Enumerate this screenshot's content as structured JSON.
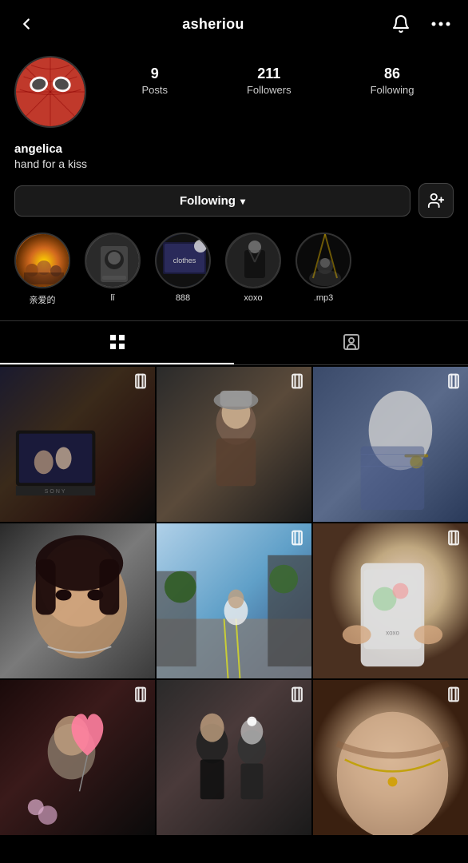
{
  "header": {
    "back_label": "‹",
    "title": "asheriou",
    "bell_icon": "🔔",
    "more_icon": "···"
  },
  "profile": {
    "avatar_alt": "Spider-Man avatar",
    "stats": [
      {
        "number": "9",
        "label": "Posts"
      },
      {
        "number": "211",
        "label": "Followers"
      },
      {
        "number": "86",
        "label": "Following"
      }
    ],
    "username": "angelica",
    "bio": "hand for a kiss"
  },
  "actions": {
    "following_label": "Following",
    "chevron": "∨",
    "add_friend_icon": "+👤"
  },
  "highlights": [
    {
      "label": "亲爱的",
      "class": "hl-1"
    },
    {
      "label": "lǐ",
      "class": "hl-2"
    },
    {
      "label": "888",
      "class": "hl-3"
    },
    {
      "label": "xoxo",
      "class": "hl-4"
    },
    {
      "label": ".mp3",
      "class": "hl-5"
    }
  ],
  "tabs": [
    {
      "id": "grid",
      "icon": "⊞",
      "active": true
    },
    {
      "id": "tagged",
      "icon": "👤",
      "active": false
    }
  ],
  "grid": [
    {
      "id": 1,
      "class": "photo-1",
      "multi": true
    },
    {
      "id": 2,
      "class": "photo-2",
      "multi": true
    },
    {
      "id": 3,
      "class": "photo-3",
      "multi": true
    },
    {
      "id": 4,
      "class": "photo-4",
      "multi": false
    },
    {
      "id": 5,
      "class": "photo-5",
      "multi": true
    },
    {
      "id": 6,
      "class": "photo-6",
      "multi": true
    },
    {
      "id": 7,
      "class": "photo-7",
      "multi": true
    },
    {
      "id": 8,
      "class": "photo-8",
      "multi": true
    },
    {
      "id": 9,
      "class": "photo-9",
      "multi": true
    }
  ]
}
